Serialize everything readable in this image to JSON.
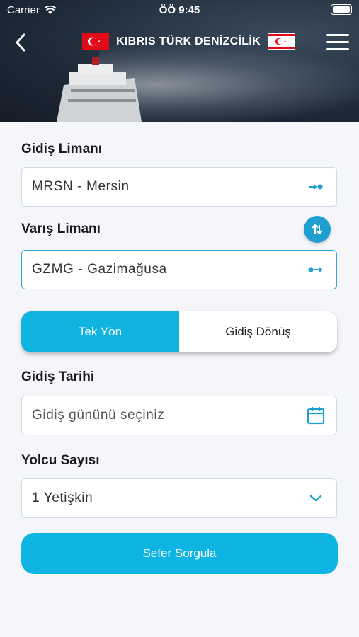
{
  "status_bar": {
    "carrier": "Carrier",
    "time": "ÖÖ 9:45"
  },
  "header": {
    "title": "KIBRIS TÜRK DENİZCİLİK"
  },
  "form": {
    "departure_label": "Gidiş Limanı",
    "departure_value": "MRSN - Mersin",
    "arrival_label": "Varış Limanı",
    "arrival_value": "GZMG - Gazimağusa",
    "trip_options": [
      "Tek Yön",
      "Gidiş Dönüş"
    ],
    "selected_trip": "Tek Yön",
    "date_label": "Gidiş Tarihi",
    "date_placeholder": "Gidiş gününü seçiniz",
    "passenger_label": "Yolcu Sayısı",
    "passenger_value": "1 Yetişkin",
    "submit_label": "Sefer Sorgula"
  },
  "colors": {
    "accent": "#10b4e0",
    "swap_button": "#1e9fd0",
    "field_border": "#d0dbe5"
  },
  "icons": [
    "back-icon",
    "turkey-flag-icon",
    "trnc-flag-icon",
    "menu-icon",
    "departure-port-icon",
    "swap-icon",
    "arrival-port-icon",
    "calendar-icon",
    "chevron-down-icon"
  ]
}
